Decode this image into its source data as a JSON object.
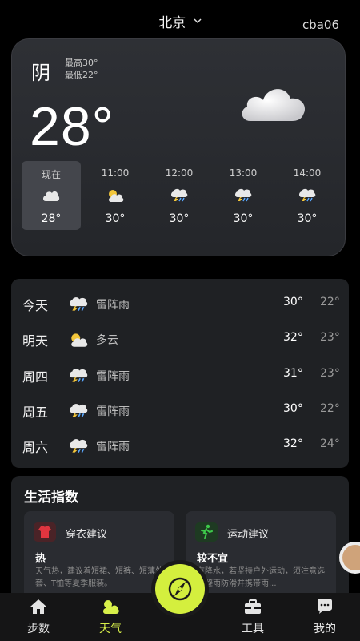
{
  "header": {
    "city": "北京",
    "user_tag": "cba06"
  },
  "current": {
    "condition": "阴",
    "high": "最高30°",
    "low": "最低22°",
    "temperature": "28°",
    "hourly": [
      {
        "time": "现在",
        "temp": "28°",
        "icon": "cloud-icon",
        "active": true
      },
      {
        "time": "11:00",
        "temp": "30°",
        "icon": "partly-cloudy-icon",
        "active": false
      },
      {
        "time": "12:00",
        "temp": "30°",
        "icon": "thunderstorm-icon",
        "active": false
      },
      {
        "time": "13:00",
        "temp": "30°",
        "icon": "thunderstorm-icon",
        "active": false
      },
      {
        "time": "14:00",
        "temp": "30°",
        "icon": "thunderstorm-icon",
        "active": false
      }
    ]
  },
  "forecast": [
    {
      "day": "今天",
      "desc": "雷阵雨",
      "high": "30°",
      "low": "22°",
      "icon": "thunderstorm-icon"
    },
    {
      "day": "明天",
      "desc": "多云",
      "high": "32°",
      "low": "23°",
      "icon": "partly-cloudy-icon"
    },
    {
      "day": "周四",
      "desc": "雷阵雨",
      "high": "31°",
      "low": "23°",
      "icon": "thunderstorm-icon"
    },
    {
      "day": "周五",
      "desc": "雷阵雨",
      "high": "30°",
      "low": "22°",
      "icon": "thunderstorm-icon"
    },
    {
      "day": "周六",
      "desc": "雷阵雨",
      "high": "32°",
      "low": "24°",
      "icon": "thunderstorm-icon"
    }
  ],
  "life": {
    "title": "生活指数",
    "cards": [
      {
        "title": "穿衣建议",
        "value": "热",
        "desc": "天气热，建议着短裙、短裤、短薄外套、T恤等夏季服装。",
        "icon": "shirt-icon",
        "color": "#e0353f"
      },
      {
        "title": "运动建议",
        "value": "较不宜",
        "desc": "有降水，若坚持户外运动，须注意选择避雨防滑并携带雨...",
        "icon": "running-icon",
        "color": "#3ec94b"
      }
    ]
  },
  "tabs": [
    {
      "label": "步数",
      "icon": "home-icon",
      "active": false
    },
    {
      "label": "天气",
      "icon": "weather-icon",
      "active": true
    },
    {
      "label": "工具",
      "icon": "toolbox-icon",
      "active": false
    },
    {
      "label": "我的",
      "icon": "chat-bubble-icon",
      "active": false
    }
  ],
  "colors": {
    "accent": "#d4ef3e",
    "background": "#000000",
    "card": "#1f2124"
  },
  "fab": {
    "icon": "compass-icon"
  }
}
